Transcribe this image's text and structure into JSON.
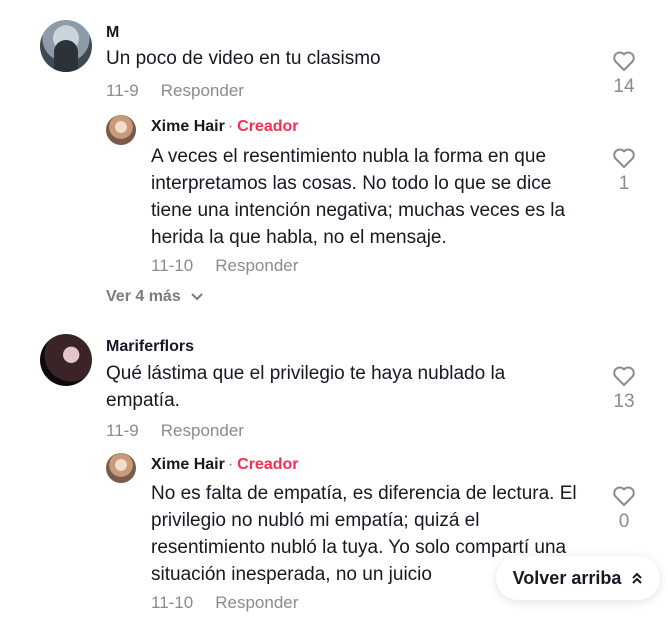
{
  "comments": [
    {
      "author": "M",
      "text": "Un poco de video en tu clasismo",
      "date": "11-9",
      "reply_label": "Responder",
      "likes": "14",
      "reply": {
        "author": "Xime Hair",
        "separator": "·",
        "tag": "Creador",
        "text": "A veces el resentimiento nubla la forma en que interpretamos las cosas. No todo lo que se dice tiene una intención negativa; muchas veces es la herida la que habla, no el mensaje.",
        "date": "11-10",
        "reply_label": "Responder",
        "likes": "1"
      },
      "more_label": "Ver 4 más"
    },
    {
      "author": "Mariferflors",
      "text": "Qué lástima que el privilegio te haya nublado la empatía.",
      "date": "11-9",
      "reply_label": "Responder",
      "likes": "13",
      "reply": {
        "author": "Xime Hair",
        "separator": "·",
        "tag": "Creador",
        "text": "No es falta de empatía, es diferencia de lectura. El privilegio no nubló mi empatía; quizá el resentimiento nubló la tuya. Yo solo compartí una situación inesperada, no un juicio",
        "date": "11-10",
        "reply_label": "Responder",
        "likes": "0"
      }
    }
  ],
  "back_to_top": "Volver arriba",
  "colors": {
    "creator_tag": "#fe2c55",
    "muted": "#8a8b91"
  },
  "icons": [
    "heart-outline-icon",
    "chevron-down-icon",
    "double-chevron-up-icon"
  ]
}
